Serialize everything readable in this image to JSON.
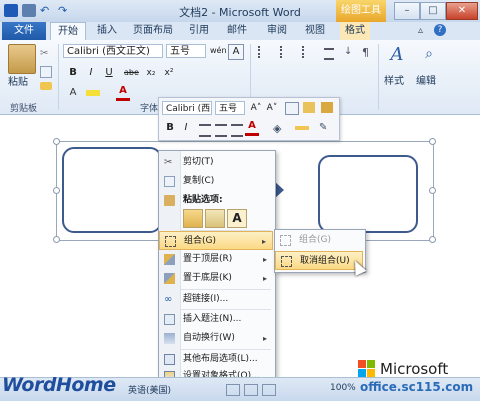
{
  "window": {
    "title": "文档2 - Microsoft Word",
    "context_tab_group": "绘图工具"
  },
  "tabs": [
    "文件",
    "开始",
    "插入",
    "页面布局",
    "引用",
    "邮件",
    "审阅",
    "视图",
    "格式"
  ],
  "ribbon": {
    "paste_label": "粘贴",
    "clipboard_group": "剪贴板",
    "font_group": "字体",
    "font_name": "Calibri (西文正文)",
    "font_size": "五号",
    "styles_label": "样式",
    "edit_label": "编辑",
    "format_buttons": [
      "B",
      "I",
      "U",
      "abe",
      "x₂",
      "x²",
      "A"
    ],
    "char_buttons": [
      "wén",
      "A"
    ]
  },
  "mini_toolbar": {
    "font_name": "Calibri (西",
    "font_size": "五号",
    "grow_font": "A˄",
    "shrink_font": "A˅",
    "bold": "B",
    "italic": "I",
    "font_color": "A"
  },
  "context_menu": {
    "items": [
      {
        "label": "剪切(T)",
        "icon": "scissors-icon"
      },
      {
        "label": "复制(C)",
        "icon": "copy-icon"
      },
      {
        "label": "粘贴选项:",
        "icon": "paste-icon",
        "bold": true
      },
      {
        "label": "组合(G)",
        "icon": "group-icon",
        "submenu": true,
        "highlighted": true
      },
      {
        "label": "置于顶层(R)",
        "icon": "bring-front-icon",
        "submenu": true
      },
      {
        "label": "置于底层(K)",
        "icon": "send-back-icon",
        "submenu": true
      },
      {
        "label": "超链接(I)...",
        "icon": "hyperlink-icon"
      },
      {
        "label": "插入题注(N)...",
        "icon": "caption-icon"
      },
      {
        "label": "自动换行(W)",
        "icon": "wrap-icon",
        "submenu": true
      },
      {
        "label": "其他布局选项(L)...",
        "icon": "layout-icon"
      },
      {
        "label": "设置对象格式(O)...",
        "icon": "format-object-icon"
      }
    ],
    "paste_option_a": "A",
    "submenu_arrow": "▸"
  },
  "submenu": {
    "items": [
      {
        "label": "组合(G)",
        "disabled": true
      },
      {
        "label": "取消组合(U)",
        "highlighted": true
      }
    ]
  },
  "status_bar": {
    "language": "英语(美国)",
    "zoom": "100%"
  },
  "watermark": {
    "left": "WordHome",
    "brand": "Microsoft",
    "site": "office.sc115.com"
  },
  "colors": {
    "file_tab": "#2a66b8",
    "highlight": "#fbd984",
    "shape_border": "#3d5a8f"
  }
}
